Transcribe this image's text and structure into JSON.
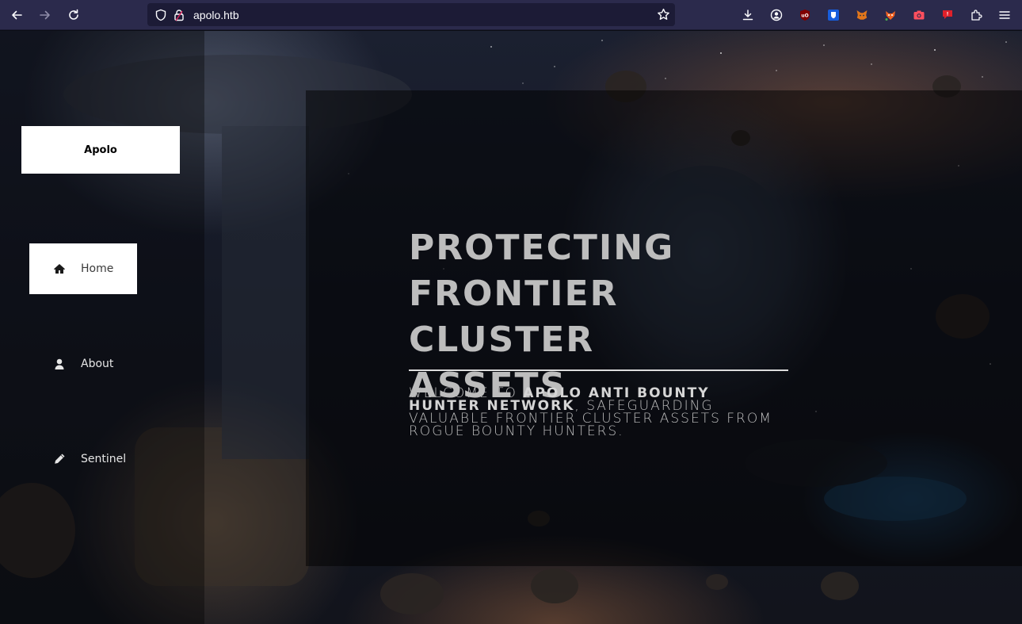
{
  "browser": {
    "url": "apolo.htb"
  },
  "site": {
    "logo_text": "Apolo",
    "nav": [
      {
        "label": "Home",
        "icon": "home-icon",
        "active": true
      },
      {
        "label": "About",
        "icon": "user-icon",
        "active": false
      },
      {
        "label": "Sentinel",
        "icon": "pencil-icon",
        "active": false
      }
    ],
    "hero": {
      "title_lines": [
        "PROTECTING",
        "FRONTIER CLUSTER",
        "ASSETS"
      ],
      "text_prefix": "WELCOME TO ",
      "text_bold": "APOLO ANTI BOUNTY HUNTER NETWORK",
      "text_suffix": ", SAFEGUARDING VALUABLE FRONTIER CLUSTER ASSETS FROM ROGUE BOUNTY HUNTERS."
    }
  },
  "colors": {
    "browser_toolbar": "#2b2a4c",
    "urlbar": "#1c1b36",
    "hero_text": "#bdbdbd"
  }
}
